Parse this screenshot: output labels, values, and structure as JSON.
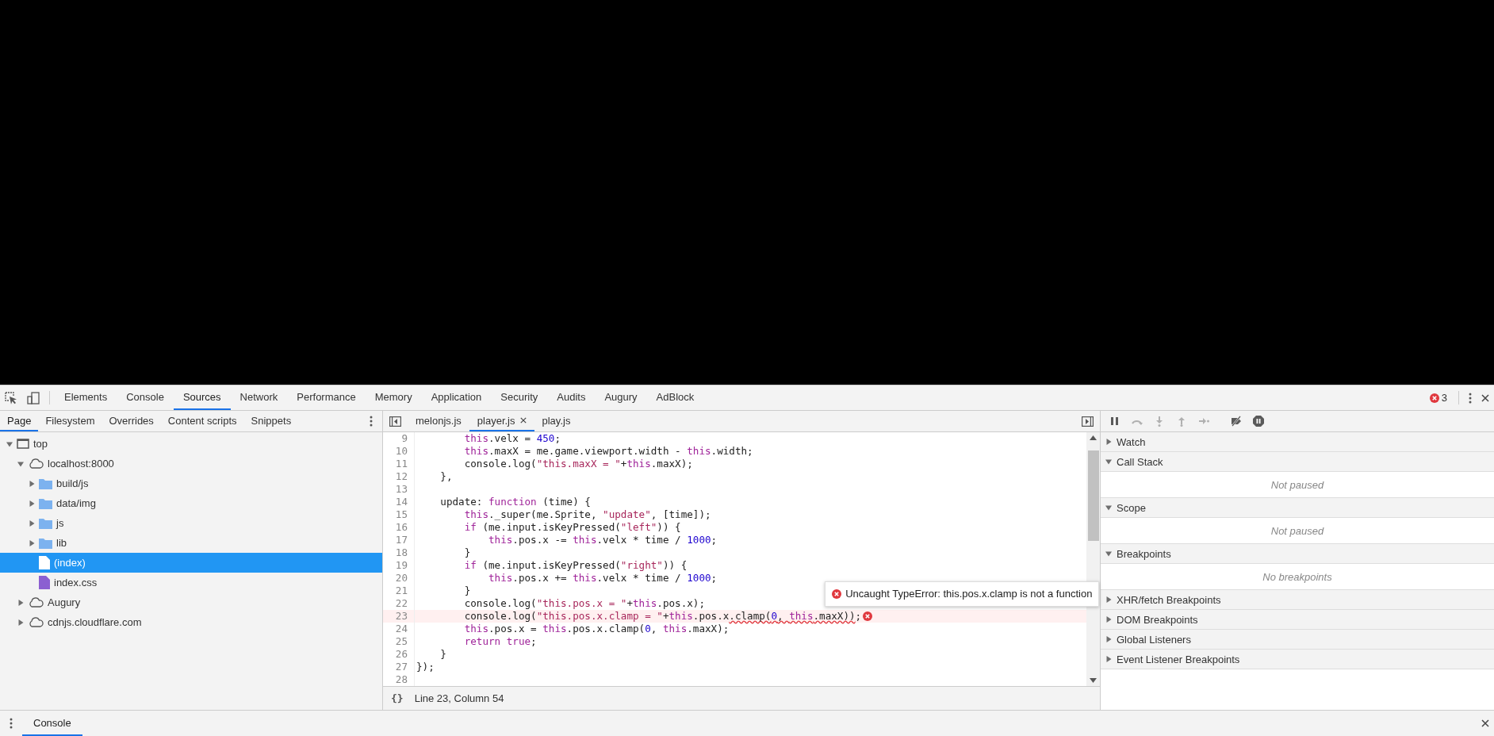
{
  "main_tabs": [
    {
      "label": "Elements",
      "selected": false
    },
    {
      "label": "Console",
      "selected": false
    },
    {
      "label": "Sources",
      "selected": true
    },
    {
      "label": "Network",
      "selected": false
    },
    {
      "label": "Performance",
      "selected": false
    },
    {
      "label": "Memory",
      "selected": false
    },
    {
      "label": "Application",
      "selected": false
    },
    {
      "label": "Security",
      "selected": false
    },
    {
      "label": "Audits",
      "selected": false
    },
    {
      "label": "Augury",
      "selected": false
    },
    {
      "label": "AdBlock",
      "selected": false
    }
  ],
  "error_count": "3",
  "navigator": {
    "tabs": [
      {
        "label": "Page",
        "selected": true
      },
      {
        "label": "Filesystem",
        "selected": false
      },
      {
        "label": "Overrides",
        "selected": false
      },
      {
        "label": "Content scripts",
        "selected": false
      },
      {
        "label": "Snippets",
        "selected": false
      }
    ],
    "tree": [
      {
        "label": "top",
        "kind": "frame",
        "expanded": true,
        "selected": false,
        "children": [
          {
            "label": "localhost:8000",
            "kind": "domain",
            "expanded": true,
            "selected": false,
            "children": [
              {
                "label": "build/js",
                "kind": "folder",
                "expanded": false,
                "selected": false
              },
              {
                "label": "data/img",
                "kind": "folder",
                "expanded": false,
                "selected": false
              },
              {
                "label": "js",
                "kind": "folder",
                "expanded": false,
                "selected": false
              },
              {
                "label": "lib",
                "kind": "folder",
                "expanded": false,
                "selected": false
              },
              {
                "label": "(index)",
                "kind": "file",
                "selected": true
              },
              {
                "label": "index.css",
                "kind": "stylesheet",
                "selected": false
              }
            ]
          },
          {
            "label": "Augury",
            "kind": "domain",
            "expanded": false,
            "selected": false
          },
          {
            "label": "cdnjs.cloudflare.com",
            "kind": "domain",
            "expanded": false,
            "selected": false
          }
        ]
      }
    ]
  },
  "editor": {
    "tabs": [
      {
        "label": "melonjs.js",
        "selected": false,
        "closable": false
      },
      {
        "label": "player.js",
        "selected": true,
        "closable": true
      },
      {
        "label": "play.js",
        "selected": false,
        "closable": false
      }
    ],
    "lines": [
      {
        "number": "9",
        "error": false,
        "segments": [
          {
            "text": "        this",
            "kind": "keyword"
          },
          {
            "text": ".velx = ",
            "kind": "plain"
          },
          {
            "text": "450",
            "kind": "number"
          },
          {
            "text": ";",
            "kind": "plain"
          }
        ]
      },
      {
        "number": "10",
        "error": false,
        "segments": [
          {
            "text": "        this",
            "kind": "keyword"
          },
          {
            "text": ".maxX = me.game.viewport.width - ",
            "kind": "plain"
          },
          {
            "text": "this",
            "kind": "keyword"
          },
          {
            "text": ".width;",
            "kind": "plain"
          }
        ]
      },
      {
        "number": "11",
        "error": false,
        "segments": [
          {
            "text": "        console.log(",
            "kind": "plain"
          },
          {
            "text": "\"this.maxX = \"",
            "kind": "string"
          },
          {
            "text": "+",
            "kind": "plain"
          },
          {
            "text": "this",
            "kind": "keyword"
          },
          {
            "text": ".maxX);",
            "kind": "plain"
          }
        ]
      },
      {
        "number": "12",
        "error": false,
        "segments": [
          {
            "text": "    },",
            "kind": "plain"
          }
        ]
      },
      {
        "number": "13",
        "error": false
      },
      {
        "number": "14",
        "error": false,
        "segments": [
          {
            "text": "    update: ",
            "kind": "plain"
          },
          {
            "text": "function",
            "kind": "keyword"
          },
          {
            "text": " (time) {",
            "kind": "plain"
          }
        ]
      },
      {
        "number": "15",
        "error": false,
        "segments": [
          {
            "text": "        this",
            "kind": "keyword"
          },
          {
            "text": "._super(me.Sprite, ",
            "kind": "plain"
          },
          {
            "text": "\"update\"",
            "kind": "string"
          },
          {
            "text": ", [time]);",
            "kind": "plain"
          }
        ]
      },
      {
        "number": "16",
        "error": false,
        "segments": [
          {
            "text": "        if",
            "kind": "keyword"
          },
          {
            "text": " (me.input.isKeyPressed(",
            "kind": "plain"
          },
          {
            "text": "\"left\"",
            "kind": "string"
          },
          {
            "text": ")) {",
            "kind": "plain"
          }
        ]
      },
      {
        "number": "17",
        "error": false,
        "segments": [
          {
            "text": "            this",
            "kind": "keyword"
          },
          {
            "text": ".pos.x -= ",
            "kind": "plain"
          },
          {
            "text": "this",
            "kind": "keyword"
          },
          {
            "text": ".velx * time / ",
            "kind": "plain"
          },
          {
            "text": "1000",
            "kind": "number"
          },
          {
            "text": ";",
            "kind": "plain"
          }
        ]
      },
      {
        "number": "18",
        "error": false,
        "segments": [
          {
            "text": "        }",
            "kind": "plain"
          }
        ]
      },
      {
        "number": "19",
        "error": false,
        "segments": [
          {
            "text": "        if",
            "kind": "keyword"
          },
          {
            "text": " (me.input.isKeyPressed(",
            "kind": "plain"
          },
          {
            "text": "\"right\"",
            "kind": "string"
          },
          {
            "text": ")) {",
            "kind": "plain"
          }
        ]
      },
      {
        "number": "20",
        "error": false,
        "segments": [
          {
            "text": "            this",
            "kind": "keyword"
          },
          {
            "text": ".pos.x += ",
            "kind": "plain"
          },
          {
            "text": "this",
            "kind": "keyword"
          },
          {
            "text": ".velx * time / ",
            "kind": "plain"
          },
          {
            "text": "1000",
            "kind": "number"
          },
          {
            "text": ";",
            "kind": "plain"
          }
        ]
      },
      {
        "number": "21",
        "error": false,
        "segments": [
          {
            "text": "        }",
            "kind": "plain"
          }
        ]
      },
      {
        "number": "22",
        "error": false,
        "segments": [
          {
            "text": "        console.log(",
            "kind": "plain"
          },
          {
            "text": "\"this.pos.x = \"",
            "kind": "string"
          },
          {
            "text": "+",
            "kind": "plain"
          },
          {
            "text": "this",
            "kind": "keyword"
          },
          {
            "text": ".pos.x);",
            "kind": "plain"
          }
        ]
      },
      {
        "number": "23",
        "error": true,
        "error_message": "Uncaught TypeError: this.pos.x.clamp is not a function",
        "segments": [
          {
            "text": "        console.log(",
            "kind": "plain",
            "underlined": false
          },
          {
            "text": "\"this.pos.x.clamp = \"",
            "kind": "string",
            "underlined": false
          },
          {
            "text": "+",
            "kind": "plain",
            "underlined": false
          },
          {
            "text": "this",
            "kind": "keyword",
            "underlined": false
          },
          {
            "text": ".pos.x",
            "kind": "plain",
            "underlined": false
          },
          {
            "text": ".clamp(",
            "kind": "plain",
            "underlined": true
          },
          {
            "text": "0",
            "kind": "number",
            "underlined": true
          },
          {
            "text": ", ",
            "kind": "plain",
            "underlined": true
          },
          {
            "text": "this",
            "kind": "keyword",
            "underlined": true
          },
          {
            "text": ".maxX))",
            "kind": "plain",
            "underlined": true
          },
          {
            "text": ";",
            "kind": "plain",
            "underlined": false
          }
        ]
      },
      {
        "number": "24",
        "error": false,
        "segments": [
          {
            "text": "        this",
            "kind": "keyword"
          },
          {
            "text": ".pos.x = ",
            "kind": "plain"
          },
          {
            "text": "this",
            "kind": "keyword"
          },
          {
            "text": ".pos.x.clamp(",
            "kind": "plain"
          },
          {
            "text": "0",
            "kind": "number"
          },
          {
            "text": ", ",
            "kind": "plain"
          },
          {
            "text": "this",
            "kind": "keyword"
          },
          {
            "text": ".maxX);",
            "kind": "plain"
          }
        ]
      },
      {
        "number": "25",
        "error": false,
        "segments": [
          {
            "text": "        return",
            "kind": "keyword"
          },
          {
            "text": " true",
            "kind": "keyword"
          },
          {
            "text": ";",
            "kind": "plain"
          }
        ]
      },
      {
        "number": "26",
        "error": false,
        "segments": [
          {
            "text": "    }",
            "kind": "plain"
          }
        ]
      },
      {
        "number": "27",
        "error": false,
        "segments": [
          {
            "text": "});",
            "kind": "plain"
          }
        ]
      },
      {
        "number": "28",
        "error": false
      }
    ],
    "pretty_print": "{}",
    "status": "Line 23, Column 54"
  },
  "debugger": {
    "controls": [
      {
        "kind": "pause",
        "disabled": false
      },
      {
        "kind": "step-over",
        "disabled": true
      },
      {
        "kind": "step-into",
        "disabled": true
      },
      {
        "kind": "step-out",
        "disabled": true
      },
      {
        "kind": "step",
        "disabled": true
      },
      {
        "kind": "deactivate",
        "disabled": false
      },
      {
        "kind": "pause-exceptions",
        "disabled": false
      }
    ],
    "sections": [
      {
        "title": "Watch",
        "expanded": false
      },
      {
        "title": "Call Stack",
        "expanded": true,
        "message": "Not paused"
      },
      {
        "title": "Scope",
        "expanded": true,
        "message": "Not paused"
      },
      {
        "title": "Breakpoints",
        "expanded": true,
        "message": "No breakpoints"
      },
      {
        "title": "XHR/fetch Breakpoints",
        "expanded": false
      },
      {
        "title": "DOM Breakpoints",
        "expanded": false
      },
      {
        "title": "Global Listeners",
        "expanded": false
      },
      {
        "title": "Event Listener Breakpoints",
        "expanded": false
      }
    ]
  },
  "drawer": {
    "tabs": [
      {
        "label": "Console",
        "selected": true
      }
    ]
  }
}
